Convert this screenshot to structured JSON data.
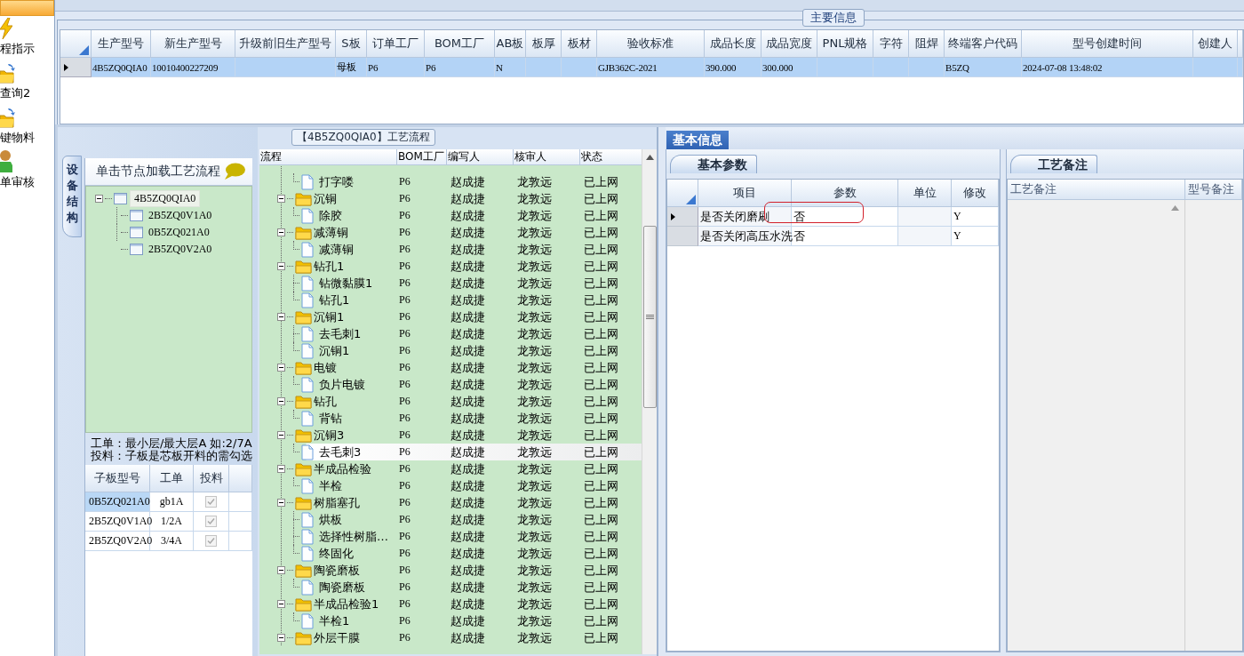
{
  "sidebar": {
    "items": [
      {
        "selected": true
      },
      {
        "label": "程指示",
        "selected": false
      },
      {
        "label": "查询2",
        "selected": false
      },
      {
        "label": "键物料",
        "selected": false
      },
      {
        "label": "单审核",
        "selected": false
      }
    ]
  },
  "main_info": {
    "title": "主要信息",
    "columns": [
      "生产型号",
      "新生产型号",
      "升级前旧生产型号",
      "S板",
      "订单工厂",
      "BOM工厂",
      "AB板",
      "板厚",
      "板材",
      "验收标准",
      "成品长度",
      "成品宽度",
      "PNL规格",
      "字符",
      "阻焊",
      "终端客户代码",
      "型号创建时间",
      "创建人"
    ],
    "rows": [
      {
        "selected": true,
        "cells": [
          "4B5ZQ0QIA0",
          "10010400227209",
          null,
          "母板",
          "P6",
          "P6",
          "N",
          null,
          null,
          "GJB362C-2021",
          "390.000",
          "300.000",
          null,
          null,
          null,
          "B5ZQ",
          "2024-07-08 13:48:02",
          null
        ]
      }
    ]
  },
  "board": {
    "tab": "设备结构",
    "hint": "单击节点加载工艺流程",
    "tree": {
      "label": "4B5ZQ0QIA0",
      "expanded": true,
      "selected": true,
      "children": [
        {
          "label": "2B5ZQ0V1A0",
          "selected": false
        },
        {
          "label": "0B5ZQ021A0",
          "selected": false
        },
        {
          "label": "2B5ZQ0V2A0",
          "selected": false
        }
      ]
    },
    "notes": [
      "工单：最小层/最大层A 如:2/7A",
      "投料：子板是芯板开料的需勾选"
    ],
    "table": {
      "columns": [
        "子板型号",
        "工单",
        "投料"
      ],
      "rows": [
        {
          "board": "0B5ZQ021A0",
          "work_order": "gb1A",
          "feed": true,
          "selected": true
        },
        {
          "board": "2B5ZQ0V1A0",
          "work_order": "1/2A",
          "feed": true,
          "selected": false
        },
        {
          "board": "2B5ZQ0V2A0",
          "work_order": "3/4A",
          "feed": true,
          "selected": false
        }
      ]
    }
  },
  "flow": {
    "title": "【4B5ZQ0QIA0】工艺流程",
    "columns": [
      "流程",
      "BOM工厂",
      "编写人",
      "核审人",
      "状态"
    ],
    "continued": [
      {
        "step": "打字喽",
        "factory": "P6",
        "writer": "赵成捷",
        "reviewer": "龙敦远",
        "status": "已上网",
        "selected": false
      }
    ],
    "groups": [
      {
        "step": "沉铜",
        "factory": "P6",
        "writer": "赵成捷",
        "reviewer": "龙敦远",
        "status": "已上网",
        "selected": false,
        "expanded": true,
        "children": [
          {
            "step": "除胶",
            "factory": "P6",
            "writer": "赵成捷",
            "reviewer": "龙敦远",
            "status": "已上网",
            "selected": false
          }
        ]
      },
      {
        "step": "减薄铜",
        "factory": "P6",
        "writer": "赵成捷",
        "reviewer": "龙敦远",
        "status": "已上网",
        "selected": false,
        "expanded": true,
        "children": [
          {
            "step": "减薄铜",
            "factory": "P6",
            "writer": "赵成捷",
            "reviewer": "龙敦远",
            "status": "已上网",
            "selected": false
          }
        ]
      },
      {
        "step": "钻孔1",
        "factory": "P6",
        "writer": "赵成捷",
        "reviewer": "龙敦远",
        "status": "已上网",
        "selected": false,
        "expanded": true,
        "children": [
          {
            "step": "钻微黏膜1",
            "factory": "P6",
            "writer": "赵成捷",
            "reviewer": "龙敦远",
            "status": "已上网",
            "selected": false
          },
          {
            "step": "钻孔1",
            "factory": "P6",
            "writer": "赵成捷",
            "reviewer": "龙敦远",
            "status": "已上网",
            "selected": false
          }
        ]
      },
      {
        "step": "沉铜1",
        "factory": "P6",
        "writer": "赵成捷",
        "reviewer": "龙敦远",
        "status": "已上网",
        "selected": false,
        "expanded": true,
        "children": [
          {
            "step": "去毛刺1",
            "factory": "P6",
            "writer": "赵成捷",
            "reviewer": "龙敦远",
            "status": "已上网",
            "selected": false
          },
          {
            "step": "沉铜1",
            "factory": "P6",
            "writer": "赵成捷",
            "reviewer": "龙敦远",
            "status": "已上网",
            "selected": false
          }
        ]
      },
      {
        "step": "电镀",
        "factory": "P6",
        "writer": "赵成捷",
        "reviewer": "龙敦远",
        "status": "已上网",
        "selected": false,
        "expanded": true,
        "children": [
          {
            "step": "负片电镀",
            "factory": "P6",
            "writer": "赵成捷",
            "reviewer": "龙敦远",
            "status": "已上网",
            "selected": false
          }
        ]
      },
      {
        "step": "钻孔",
        "factory": "P6",
        "writer": "赵成捷",
        "reviewer": "龙敦远",
        "status": "已上网",
        "selected": false,
        "expanded": true,
        "children": [
          {
            "step": "背钻",
            "factory": "P6",
            "writer": "赵成捷",
            "reviewer": "龙敦远",
            "status": "已上网",
            "selected": false
          }
        ]
      },
      {
        "step": "沉铜3",
        "factory": "P6",
        "writer": "赵成捷",
        "reviewer": "龙敦远",
        "status": "已上网",
        "selected": false,
        "expanded": true,
        "children": [
          {
            "step": "去毛刺3",
            "factory": "P6",
            "writer": "赵成捷",
            "reviewer": "龙敦远",
            "status": "已上网",
            "selected": true
          }
        ]
      },
      {
        "step": "半成品检验",
        "factory": "P6",
        "writer": "赵成捷",
        "reviewer": "龙敦远",
        "status": "已上网",
        "selected": false,
        "expanded": true,
        "children": [
          {
            "step": "半检",
            "factory": "P6",
            "writer": "赵成捷",
            "reviewer": "龙敦远",
            "status": "已上网",
            "selected": false
          }
        ]
      },
      {
        "step": "树脂塞孔",
        "factory": "P6",
        "writer": "赵成捷",
        "reviewer": "龙敦远",
        "status": "已上网",
        "selected": false,
        "expanded": true,
        "children": [
          {
            "step": "烘板",
            "factory": "P6",
            "writer": "赵成捷",
            "reviewer": "龙敦远",
            "status": "已上网",
            "selected": false
          },
          {
            "step": "选择性树脂…",
            "factory": "P6",
            "writer": "赵成捷",
            "reviewer": "龙敦远",
            "status": "已上网",
            "selected": false
          },
          {
            "step": "终固化",
            "factory": "P6",
            "writer": "赵成捷",
            "reviewer": "龙敦远",
            "status": "已上网",
            "selected": false
          }
        ]
      },
      {
        "step": "陶瓷磨板",
        "factory": "P6",
        "writer": "赵成捷",
        "reviewer": "龙敦远",
        "status": "已上网",
        "selected": false,
        "expanded": true,
        "children": [
          {
            "step": "陶瓷磨板",
            "factory": "P6",
            "writer": "赵成捷",
            "reviewer": "龙敦远",
            "status": "已上网",
            "selected": false
          }
        ]
      },
      {
        "step": "半成品检验1",
        "factory": "P6",
        "writer": "赵成捷",
        "reviewer": "龙敦远",
        "status": "已上网",
        "selected": false,
        "expanded": true,
        "children": [
          {
            "step": "半检1",
            "factory": "P6",
            "writer": "赵成捷",
            "reviewer": "龙敦远",
            "status": "已上网",
            "selected": false
          }
        ]
      },
      {
        "step": "外层干膜",
        "factory": "P6",
        "writer": "赵成捷",
        "reviewer": "龙敦远",
        "status": "已上网",
        "selected": false,
        "expanded": true
      }
    ]
  },
  "basic_info": {
    "tab": "基本信息",
    "params_tab": "基本参数",
    "columns": [
      "项目",
      "参数",
      "单位",
      "修改"
    ],
    "rows": [
      {
        "item": "是否关闭磨刷",
        "value": "否",
        "modified": "Y",
        "selected": true,
        "highlighted": true
      },
      {
        "item": "是否关闭高压水洗",
        "value": "否",
        "modified": "Y",
        "selected": false,
        "highlighted": false
      }
    ],
    "notes_tab": "工艺备注",
    "notes_columns": [
      "工艺备注",
      "型号备注"
    ]
  }
}
